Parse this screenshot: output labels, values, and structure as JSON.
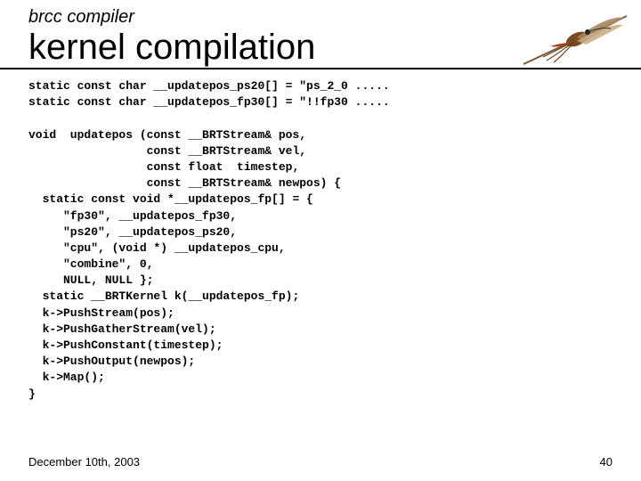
{
  "header": {
    "subtitle": "brcc compiler",
    "title": "kernel compilation"
  },
  "code": {
    "line1": "static const char __updatepos_ps20[] = \"ps_2_0 .....",
    "line2": "static const char __updatepos_fp30[] = \"!!fp30 .....",
    "line3": "",
    "line4": "void  updatepos (const __BRTStream& pos,",
    "line5": "                 const __BRTStream& vel,",
    "line6": "                 const float  timestep,",
    "line7": "                 const __BRTStream& newpos) {",
    "line8": "  static const void *__updatepos_fp[] = {",
    "line9": "     \"fp30\", __updatepos_fp30,",
    "line10": "     \"ps20\", __updatepos_ps20,",
    "line11": "     \"cpu\", (void *) __updatepos_cpu,",
    "line12": "     \"combine\", 0,",
    "line13": "     NULL, NULL };",
    "line14": "  static __BRTKernel k(__updatepos_fp);",
    "line15": "  k->PushStream(pos);",
    "line16": "  k->PushGatherStream(vel);",
    "line17": "  k->PushConstant(timestep);",
    "line18": "  k->PushOutput(newpos);",
    "line19": "  k->Map();",
    "line20": "}"
  },
  "footer": {
    "date": "December 10th, 2003",
    "page": "40"
  }
}
